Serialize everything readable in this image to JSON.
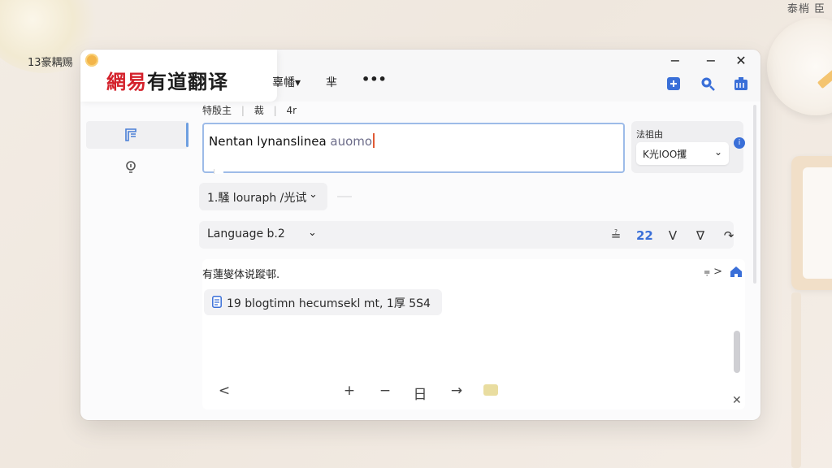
{
  "desktop": {
    "top_left_label": "13豪耦赐",
    "top_right_label": "泰梢 臣"
  },
  "window": {
    "app_name_red": "網易",
    "app_name_dark": "有道翻译",
    "menu": {
      "item1": "辜幡▾",
      "item2": "芈",
      "more": "•••"
    },
    "controls": {
      "min": "−",
      "max": "−",
      "close": "✕"
    }
  },
  "input_panel": {
    "subtabs": [
      "特殷主",
      "|",
      "裁",
      "|",
      "4r"
    ],
    "text": "Nentan lynanslinea ",
    "text_light": "auomo",
    "side_label": "法祖由",
    "side_value": "K光IOO攫",
    "side_badge": "i",
    "side_mini": "⁴"
  },
  "language_selectors": {
    "source": "1.騒 louraph /光试",
    "target": "Language b.2"
  },
  "toolbar": [
    "≟",
    "22",
    "V",
    "∇",
    "↷"
  ],
  "result": {
    "title": "有蓮燮体说蹤邨.",
    "nav": "⩦ >",
    "chip_text": "19 blogtimn hecumsekl mt,  1厚 5S4"
  },
  "bottom_bar": {
    "back": "<",
    "b2": "+",
    "b3": "−",
    "b4": "日",
    "b5": "→",
    "close": "✕"
  }
}
